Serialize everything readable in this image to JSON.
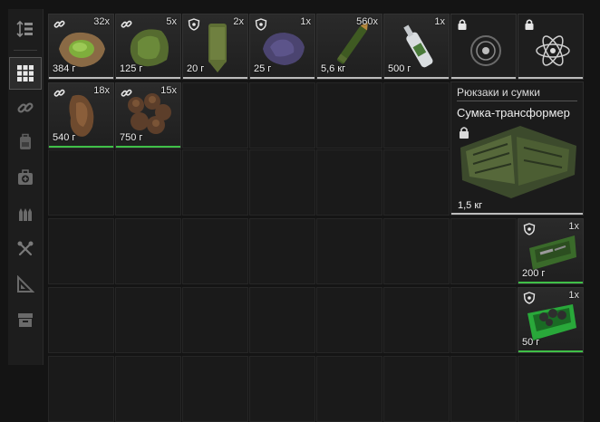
{
  "sidebar": {
    "items": [
      {
        "icon": "sort-icon",
        "active": false
      },
      {
        "icon": "grid-icon",
        "active": true
      },
      {
        "icon": "link-icon",
        "active": false
      },
      {
        "icon": "backpack-icon",
        "active": false
      },
      {
        "icon": "medkit-icon",
        "active": false
      },
      {
        "icon": "ammo-icon",
        "active": false
      },
      {
        "icon": "tools-icon",
        "active": false
      },
      {
        "icon": "ruler-icon",
        "active": false
      },
      {
        "icon": "storage-box-icon",
        "active": false
      }
    ]
  },
  "items": [
    {
      "id": "mutant-part-green",
      "badge": "link-icon",
      "qty": "32x",
      "weight": "384 г"
    },
    {
      "id": "moss-artifact",
      "badge": "link-icon",
      "qty": "5x",
      "weight": "125 г"
    },
    {
      "id": "cloth-bundle",
      "badge": "shield-icon",
      "qty": "2x",
      "weight": "20 г"
    },
    {
      "id": "purple-rock",
      "badge": "shield-icon",
      "qty": "1x",
      "weight": "25 г"
    },
    {
      "id": "rifle-cartridges",
      "badge": "",
      "qty": "560x",
      "weight": "5,6 кг"
    },
    {
      "id": "vodka-bottle",
      "badge": "",
      "qty": "1x",
      "weight": "500 г"
    },
    {
      "id": "artifact-orb",
      "badge": "lock-icon",
      "qty": "",
      "weight": ""
    },
    {
      "id": "atom-artifact",
      "badge": "lock-icon",
      "qty": "",
      "weight": ""
    },
    {
      "id": "brown-fur",
      "badge": "link-icon",
      "qty": "18x",
      "weight": "540 г"
    },
    {
      "id": "brown-mushrooms",
      "badge": "link-icon",
      "qty": "15x",
      "weight": "750 г"
    },
    {
      "id": "green-toolcase",
      "badge": "shield-icon",
      "qty": "1x",
      "weight": "200 г"
    },
    {
      "id": "green-parts-crate",
      "badge": "shield-icon",
      "qty": "1x",
      "weight": "50 г"
    }
  ],
  "backpack_panel": {
    "category": "Рюкзаки и сумки",
    "name": "Сумка-трансформер",
    "weight": "1,5 кг"
  },
  "colors": {
    "underline_green": "#3fbf47",
    "underline_grey": "#bcbcbc"
  }
}
